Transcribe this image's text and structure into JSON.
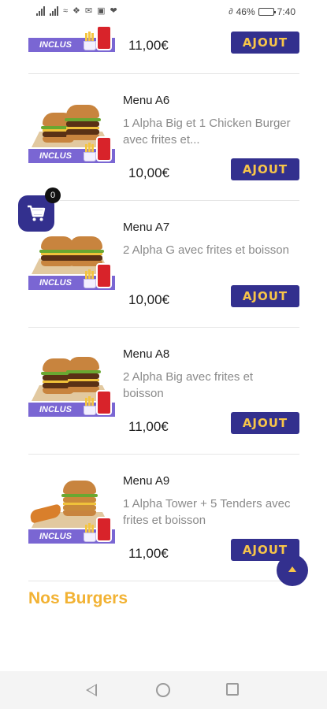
{
  "status_bar": {
    "battery_percent": "46%",
    "time": "7:40"
  },
  "colors": {
    "brand": "#33308e",
    "accent": "#f7c549",
    "section_title": "#f2b233",
    "badge": "#7a66d3"
  },
  "menu": {
    "badge_label": "INCLUS",
    "add_label": "AJOUT",
    "top_item": {
      "price": "11,00€"
    },
    "items": [
      {
        "name": "Menu A6",
        "description": "1 Alpha Big et 1 Chicken Burger avec frites et...",
        "price": "10,00€"
      },
      {
        "name": "Menu A7",
        "description": "2 Alpha G avec frites et boisson",
        "price": "10,00€"
      },
      {
        "name": "Menu A8",
        "description": "2 Alpha Big avec frites et boisson",
        "price": "11,00€"
      },
      {
        "name": "Menu A9",
        "description": "1 Alpha Tower + 5 Tenders avec frites et boisson",
        "price": "11,00€"
      }
    ]
  },
  "cart": {
    "count": "0",
    "icon": "shopping-cart-icon"
  },
  "section": {
    "title": "Nos Burgers"
  },
  "nav": {
    "icons": [
      "back-icon",
      "home-icon",
      "recents-icon"
    ]
  }
}
